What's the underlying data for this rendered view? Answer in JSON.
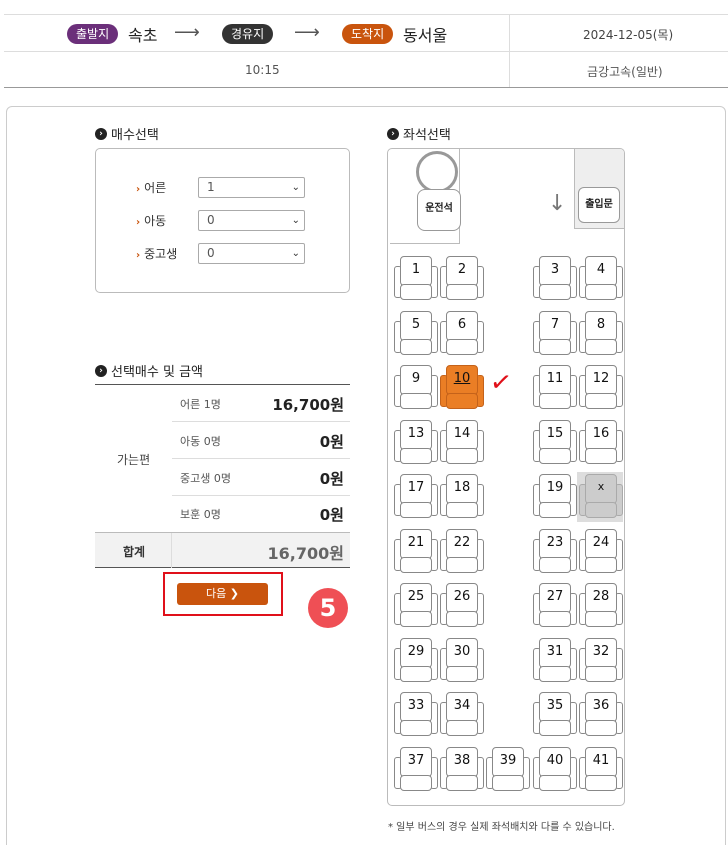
{
  "route": {
    "departure_badge": "출발지",
    "departure_city": "속초",
    "via_badge": "경유지",
    "arrival_badge": "도착지",
    "arrival_city": "동서울",
    "date": "2024-12-05(목)",
    "time": "10:15",
    "company": "금강고속(일반)",
    "arrow_glyph": "⟶",
    "colors": {
      "departure": "#6b2f7a",
      "via": "#333333",
      "arrival": "#c9540d"
    }
  },
  "ticket_count": {
    "title": "매수선택",
    "rows": [
      {
        "label": "어른",
        "value": "1"
      },
      {
        "label": "아동",
        "value": "0"
      },
      {
        "label": "중고생",
        "value": "0"
      }
    ]
  },
  "summary": {
    "title": "선택매수 및 금액",
    "side_label": "가는편",
    "rows": [
      {
        "label": "어른 1명",
        "amount": "16,700원"
      },
      {
        "label": "아동 0명",
        "amount": "0원"
      },
      {
        "label": "중고생 0명",
        "amount": "0원"
      },
      {
        "label": "보훈 0명",
        "amount": "0원"
      }
    ],
    "total_label": "합계",
    "total_amount": "16,700원"
  },
  "next_button": {
    "label": "다음 ❯"
  },
  "step_badge": "5",
  "seat_map": {
    "title": "좌석선택",
    "driver_label": "운전석",
    "door_label": "출입문",
    "selected_seat": "10",
    "accent_color": "#ea7e25",
    "taken_marker": "x"
  },
  "notes": {
    "line1": "* 일부 버스의 경우 실제 좌석배치와 다를 수 있습니다."
  }
}
